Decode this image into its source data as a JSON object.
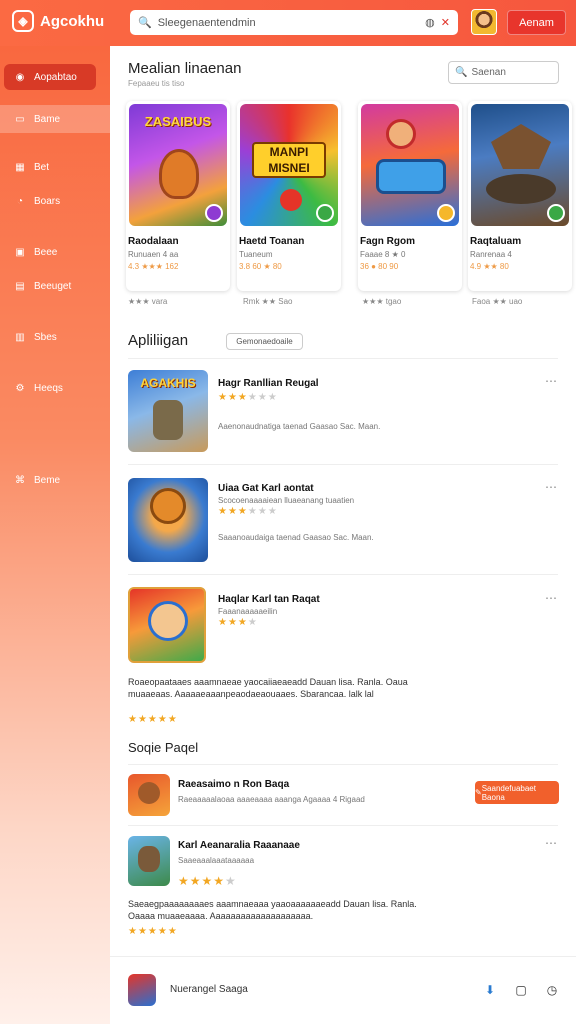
{
  "app": {
    "title": "Agcokhu"
  },
  "search": {
    "placeholder": "Sleegenaentendmin"
  },
  "header": {
    "action_label": "Aenam"
  },
  "sidebar": {
    "items": [
      {
        "label": "Aopabtao",
        "icon": "gamepad-icon"
      },
      {
        "label": "Bame",
        "icon": "folder-icon"
      },
      {
        "label": "Bet",
        "icon": "grid-icon"
      },
      {
        "label": "Boars",
        "icon": "chat-icon"
      },
      {
        "label": "Beee",
        "icon": "image-icon"
      },
      {
        "label": "Beeuget",
        "icon": "list-icon"
      },
      {
        "label": "Sbes",
        "icon": "calendar-icon"
      },
      {
        "label": "Heeqs",
        "icon": "settings-icon"
      },
      {
        "label": "Beme",
        "icon": "link-icon"
      }
    ]
  },
  "featured": {
    "title": "Mealian linaenan",
    "subtitle": "Fepaaeu tis tiso",
    "search_placeholder": "Saenan",
    "cards": [
      {
        "title": "Raodalaan",
        "meta": "Runuaen 4 aa",
        "rating": "4.3 ★★★ 162",
        "sub": "★★★ vara",
        "art_text": "ZASAIBUS"
      },
      {
        "title": "Haetd Toanan",
        "meta": "Tuaneum",
        "rating": "3.8 60 ★ 80",
        "sub": "Rmk ★★ Sao",
        "art_text": "MANPI MISNEI"
      },
      {
        "title": "Fagn Rgom",
        "meta": "Faaae 8 ★ 0",
        "rating": "36 ● 80 90",
        "sub": "★★★ tgao",
        "art_text": ""
      },
      {
        "title": "Raqtaluam",
        "meta": "Ranrenaa 4",
        "rating": "4.9 ★★ 80",
        "sub": "Faoa ★★ uao",
        "art_text": ""
      }
    ]
  },
  "apps": {
    "title": "Apliliigan",
    "filter_label": "Gemonaedoaile",
    "rows": [
      {
        "title": "Hagr Ranllian Reugal",
        "desc": "Aaenonaudnatiga taenad Gaasao Sac. Maan.",
        "art_text": "AGAKHIS"
      },
      {
        "title": "Uiaa Gat Karl aontat",
        "sub": "Scocoenaaaaiean lluaeanang tuaatien",
        "desc": "Saaanoaudaiga taenad Gaasao Sac. Maan."
      },
      {
        "title": "Haqlar Karl tan Raqat",
        "sub": "Faaanaaaaaeilin"
      }
    ],
    "long_desc": "Roaeopaataaes aaamnaeae yaocaiiaeaeadd Dauan lisa. Ranla. Oaua muaaeaas. Aaaaaeaaanpeaodaeaouaaes. Sbarancaa. lalk lal"
  },
  "social": {
    "title": "Soqie Paqel",
    "rows": [
      {
        "title": "Raeasaimo n Ron Baqa",
        "sub": "Raeaaaaalaoaa aaaeaaaa aaanga Agaaaa 4 Rigaad"
      },
      {
        "title": "Karl Aeanaralia Raaanaae",
        "sub": "Saaeaaalaaataaaaaa"
      }
    ],
    "cta_label": "Saandefuabaet Baona",
    "long_desc": "Saeaegpaaaaaaaaes aaamnaeaaa yaaoaaaaaaeadd Dauan lisa. Ranla. Oaaaa muaaeaaaa. Aaaaaaaaaaaaaaaaaaaa."
  },
  "bottombar": {
    "label": "Nuerangel Saaga"
  }
}
